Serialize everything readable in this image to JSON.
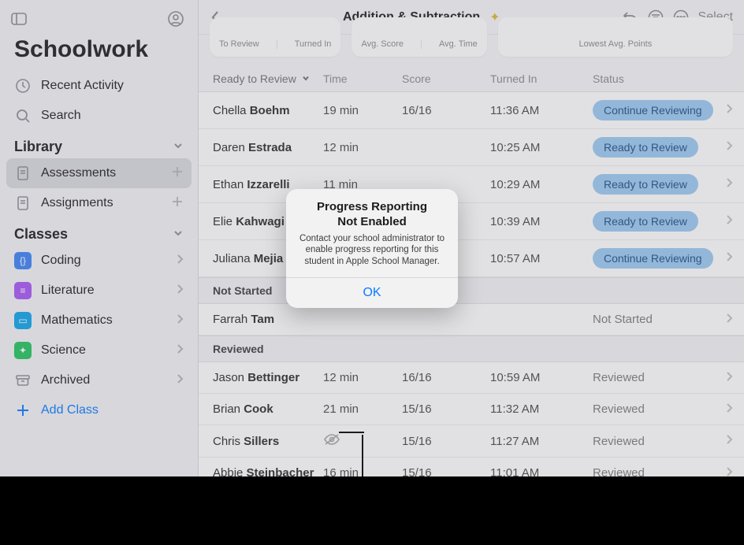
{
  "sidebar": {
    "app_title": "Schoolwork",
    "recent_label": "Recent Activity",
    "search_label": "Search",
    "library": {
      "header": "Library",
      "items": [
        {
          "label": "Assessments",
          "selected": true,
          "trail": "plus"
        },
        {
          "label": "Assignments",
          "selected": false,
          "trail": "plus"
        }
      ]
    },
    "classes": {
      "header": "Classes",
      "items": [
        {
          "label": "Coding",
          "color": "#3b82f6",
          "glyph": "{}"
        },
        {
          "label": "Literature",
          "color": "#a855f7",
          "glyph": "≡"
        },
        {
          "label": "Mathematics",
          "color": "#0ea5e9",
          "glyph": "▭"
        },
        {
          "label": "Science",
          "color": "#22c55e",
          "glyph": "✦"
        },
        {
          "label": "Archived",
          "color": "#9ca3af",
          "glyph": "▭",
          "archived": true
        }
      ],
      "add_label": "Add Class"
    }
  },
  "header": {
    "title": "Addition & Subtraction",
    "select_label": "Select"
  },
  "cards": {
    "c1a": "To Review",
    "c1b": "Turned In",
    "c2a": "Avg. Score",
    "c2b": "Avg. Time",
    "c3": "Lowest Avg. Points"
  },
  "columns": {
    "sort": "Ready to Review",
    "time": "Time",
    "score": "Score",
    "turned": "Turned In",
    "status": "Status"
  },
  "sections": {
    "not_started": "Not Started",
    "reviewed": "Reviewed"
  },
  "statuses": {
    "continue": "Continue Reviewing",
    "ready": "Ready to Review",
    "not_started": "Not Started",
    "reviewed": "Reviewed"
  },
  "rows_ready": [
    {
      "first": "Chella",
      "last": "Boehm",
      "time": "19 min",
      "score": "16/16",
      "turned": "11:36 AM",
      "status": "continue"
    },
    {
      "first": "Daren",
      "last": "Estrada",
      "time": "12 min",
      "score": "",
      "turned": "10:25 AM",
      "status": "ready"
    },
    {
      "first": "Ethan",
      "last": "Izzarelli",
      "time": "11 min",
      "score": "",
      "turned": "10:29 AM",
      "status": "ready"
    },
    {
      "first": "Elie",
      "last": "Kahwagi",
      "time": "",
      "score": "",
      "turned": "10:39 AM",
      "status": "ready"
    },
    {
      "first": "Juliana",
      "last": "Mejia",
      "time": "",
      "score": "",
      "turned": "10:57 AM",
      "status": "continue"
    }
  ],
  "rows_notstarted": [
    {
      "first": "Farrah",
      "last": "Tam",
      "time": "",
      "score": "",
      "turned": "",
      "status": "not_started"
    }
  ],
  "rows_reviewed": [
    {
      "first": "Jason",
      "last": "Bettinger",
      "time": "12 min",
      "score": "16/16",
      "turned": "10:59 AM",
      "status": "reviewed"
    },
    {
      "first": "Brian",
      "last": "Cook",
      "time": "21 min",
      "score": "15/16",
      "turned": "11:32 AM",
      "status": "reviewed"
    },
    {
      "first": "Chris",
      "last": "Sillers",
      "time": "",
      "score": "15/16",
      "turned": "11:27 AM",
      "status": "reviewed",
      "eyeoff": true
    },
    {
      "first": "Abbie",
      "last": "Steinbacher",
      "time": "16 min",
      "score": "15/16",
      "turned": "11:01 AM",
      "status": "reviewed"
    }
  ],
  "modal": {
    "title_l1": "Progress Reporting",
    "title_l2": "Not Enabled",
    "message": "Contact your school administrator to enable progress reporting for this student in Apple School Manager.",
    "ok": "OK"
  }
}
